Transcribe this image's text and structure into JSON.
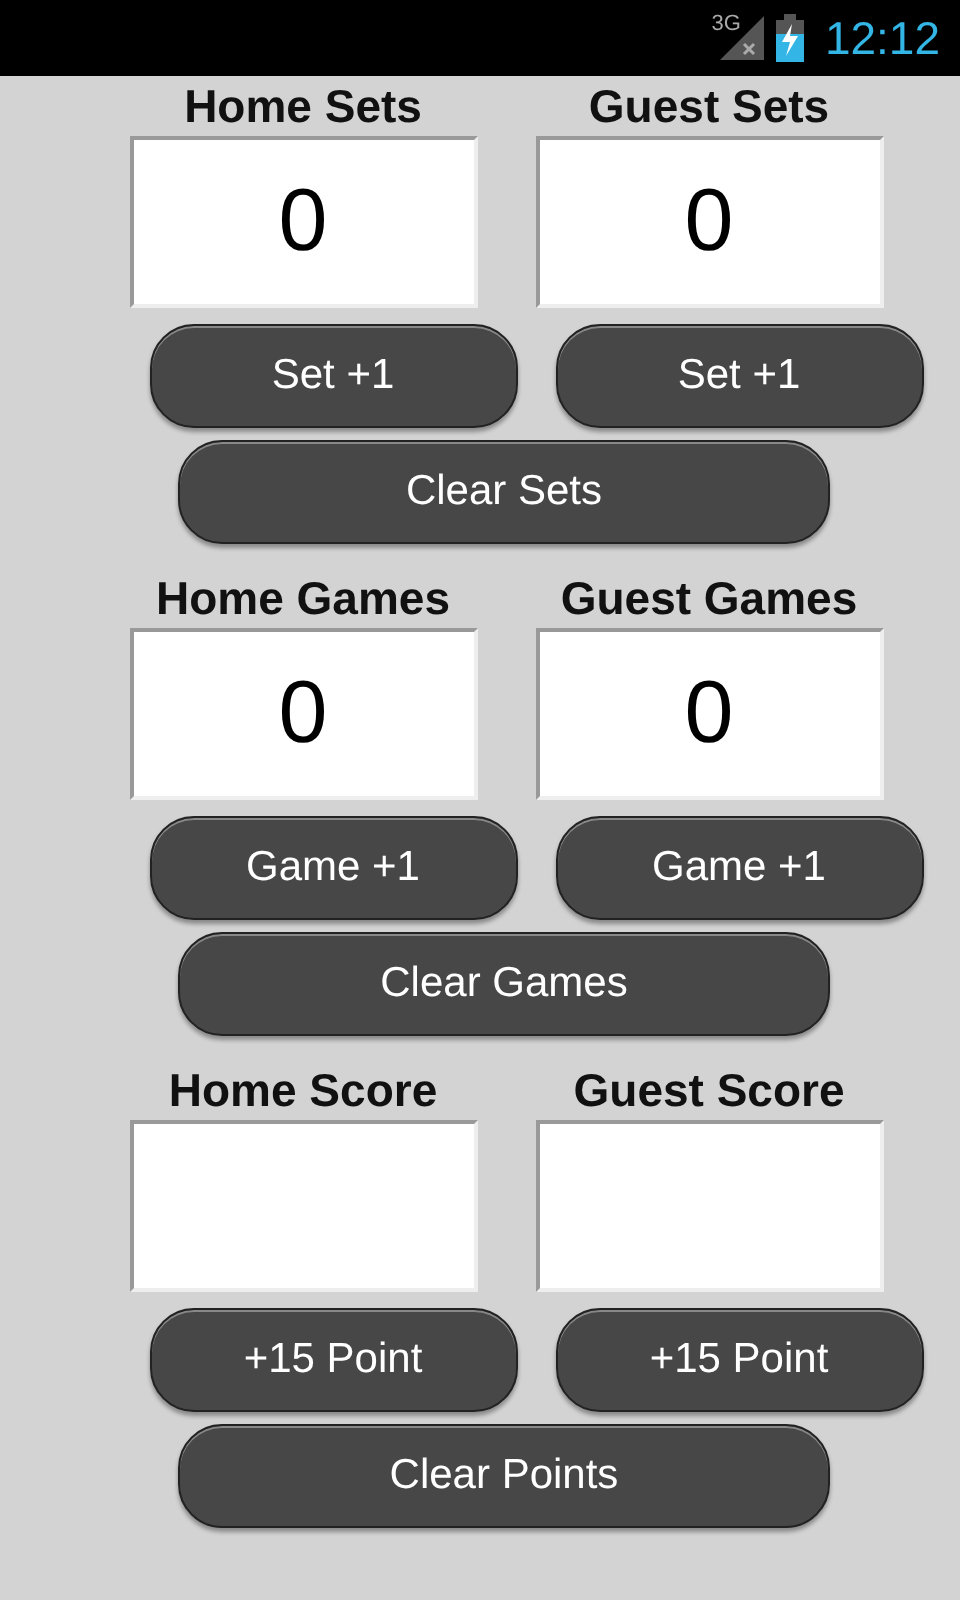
{
  "status_bar": {
    "network": "3G",
    "time": "12:12"
  },
  "sections": [
    {
      "home_label": "Home Sets",
      "guest_label": "Guest Sets",
      "home_value": "0",
      "guest_value": "0",
      "home_button": "Set +1",
      "guest_button": "Set +1",
      "clear_button": "Clear Sets"
    },
    {
      "home_label": "Home Games",
      "guest_label": "Guest Games",
      "home_value": "0",
      "guest_value": "0",
      "home_button": "Game +1",
      "guest_button": "Game +1",
      "clear_button": "Clear Games"
    },
    {
      "home_label": "Home Score",
      "guest_label": "Guest Score",
      "home_button": "+15 Point",
      "guest_button": "+15 Point",
      "clear_button": "Clear Points"
    }
  ]
}
